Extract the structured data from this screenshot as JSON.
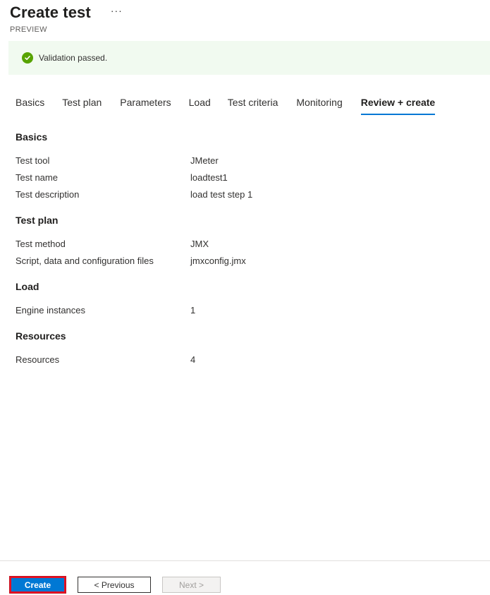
{
  "header": {
    "title": "Create test",
    "more_icon": "more-horizontal-icon",
    "more_glyph": "···",
    "subtitle": "PREVIEW"
  },
  "banner": {
    "icon": "success-check-icon",
    "text": "Validation passed.",
    "color": "#57a300",
    "background": "#f1faf0"
  },
  "tabs": [
    {
      "label": "Basics",
      "active": false
    },
    {
      "label": "Test plan",
      "active": false
    },
    {
      "label": "Parameters",
      "active": false
    },
    {
      "label": "Load",
      "active": false
    },
    {
      "label": "Test criteria",
      "active": false
    },
    {
      "label": "Monitoring",
      "active": false
    },
    {
      "label": "Review + create",
      "active": true
    }
  ],
  "review": {
    "sections": [
      {
        "title": "Basics",
        "rows": [
          {
            "label": "Test tool",
            "value": "JMeter"
          },
          {
            "label": "Test name",
            "value": "loadtest1"
          },
          {
            "label": "Test description",
            "value": "load test step 1"
          }
        ]
      },
      {
        "title": "Test plan",
        "rows": [
          {
            "label": "Test method",
            "value": "JMX"
          },
          {
            "label": "Script, data and configuration files",
            "value": "jmxconfig.jmx"
          }
        ]
      },
      {
        "title": "Load",
        "rows": [
          {
            "label": "Engine instances",
            "value": "1"
          }
        ]
      },
      {
        "title": "Resources",
        "rows": [
          {
            "label": "Resources",
            "value": "4"
          }
        ]
      }
    ]
  },
  "footer": {
    "create_label": "Create",
    "previous_label": "< Previous",
    "next_label": "Next >",
    "accent_color": "#0078d4",
    "highlight_color": "#e81123"
  }
}
